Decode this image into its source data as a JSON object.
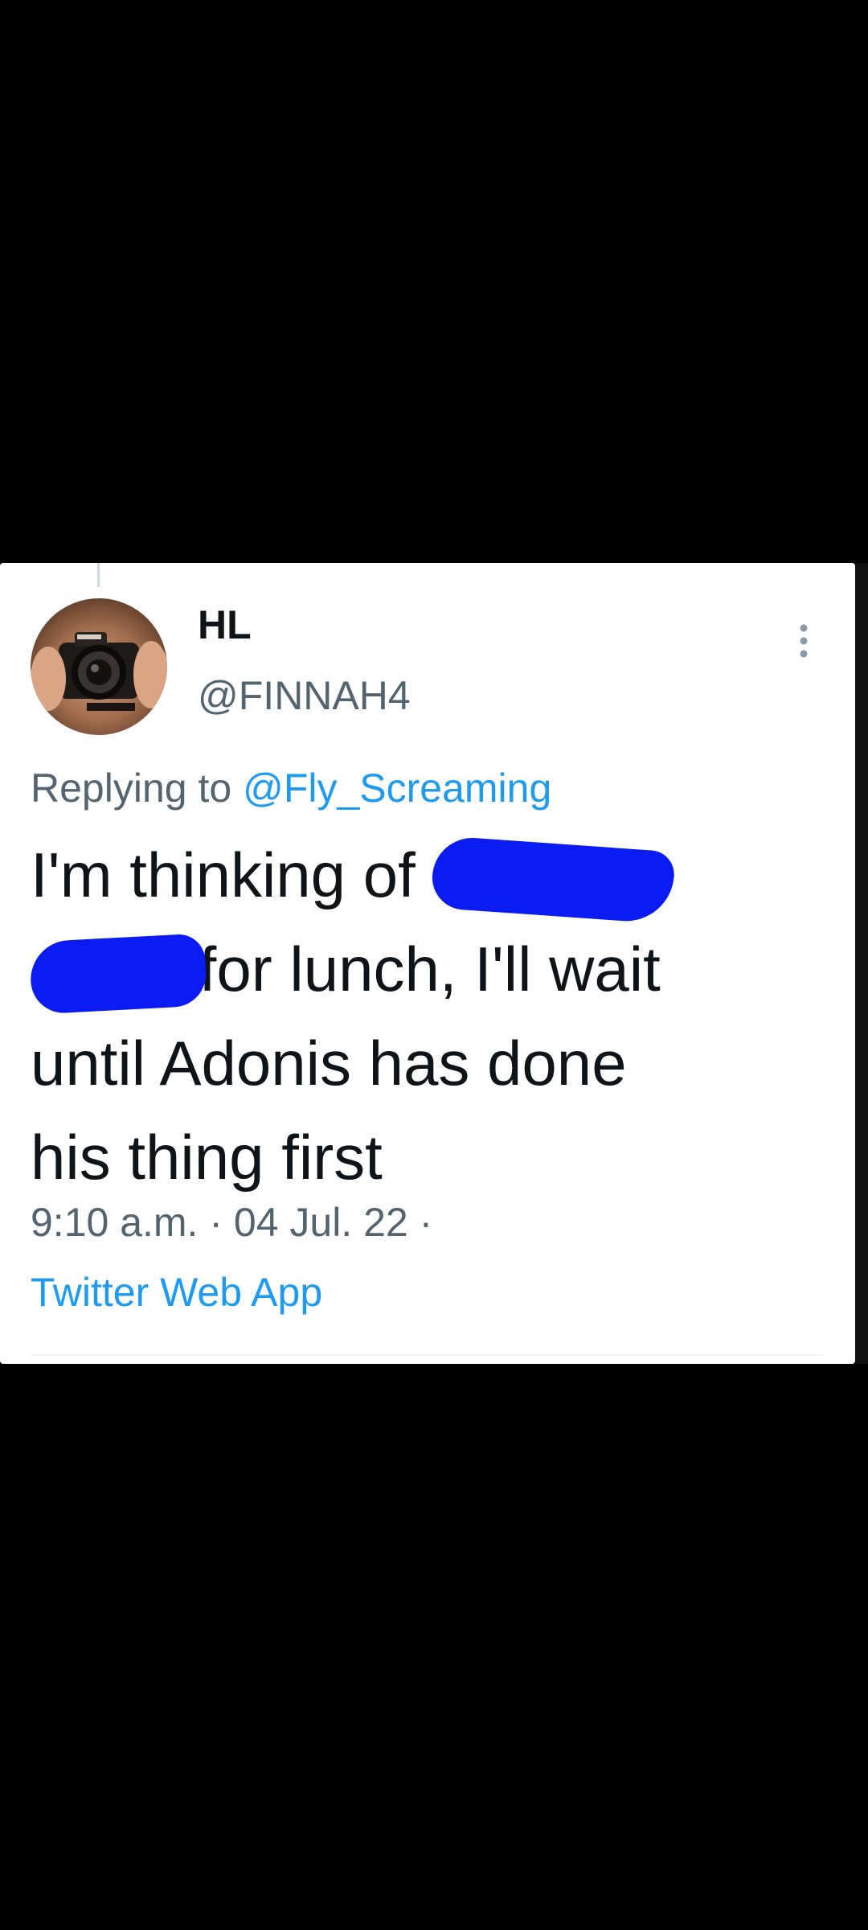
{
  "tweet": {
    "display_name": "HL",
    "handle": "@FINNAH4",
    "replying_prefix": "Replying to",
    "replying_to": "@Fly_Screaming",
    "text_line1_before": "I'm thinking of",
    "text_line2_after": "for lunch, I'll wait",
    "text_line3": "until Adonis has done",
    "text_line4": "his thing first",
    "timestamp": "9:10 a.m. · 04 Jul. 22 ·",
    "source": "Twitter Web App"
  },
  "icons": {
    "more": "more-vertical-icon",
    "avatar": "camera-photo-avatar"
  },
  "colors": {
    "background": "#000000",
    "card": "#ffffff",
    "text": "#0f1419",
    "secondary": "#536471",
    "link": "#1d9bf0",
    "redaction": "#0a1cf2"
  }
}
